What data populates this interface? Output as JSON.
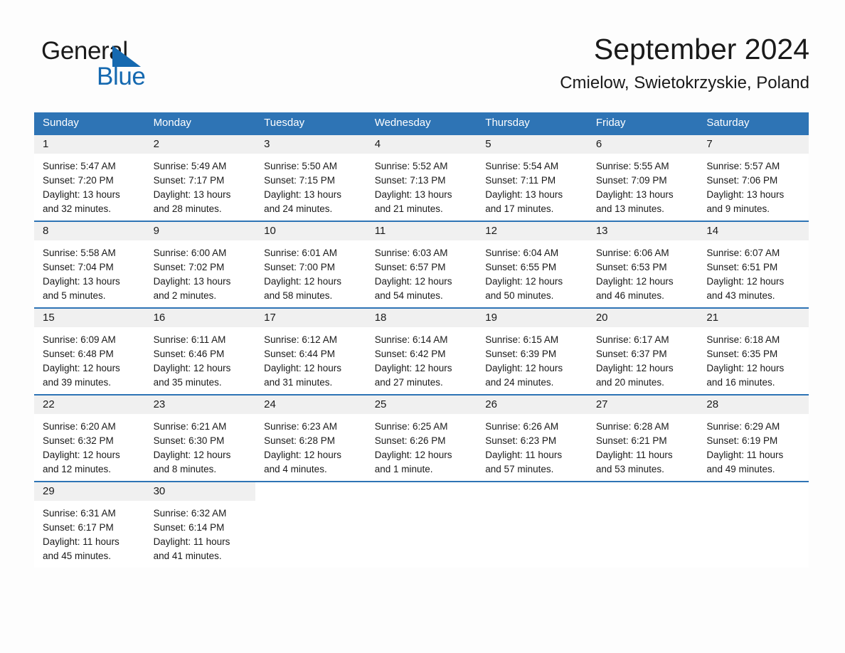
{
  "brand": {
    "name_part1": "General",
    "name_part2": "Blue",
    "accent_color": "#1569b0"
  },
  "header": {
    "title": "September 2024",
    "subtitle": "Cmielow, Swietokrzyskie, Poland"
  },
  "theme": {
    "header_blue": "#2e74b5",
    "daynum_band": "#f0f0f0",
    "page_background": "#fdfdfd"
  },
  "weekdays": [
    "Sunday",
    "Monday",
    "Tuesday",
    "Wednesday",
    "Thursday",
    "Friday",
    "Saturday"
  ],
  "weeks": [
    [
      {
        "day": "1",
        "sunrise": "Sunrise: 5:47 AM",
        "sunset": "Sunset: 7:20 PM",
        "daylight": "Daylight: 13 hours and 32 minutes."
      },
      {
        "day": "2",
        "sunrise": "Sunrise: 5:49 AM",
        "sunset": "Sunset: 7:17 PM",
        "daylight": "Daylight: 13 hours and 28 minutes."
      },
      {
        "day": "3",
        "sunrise": "Sunrise: 5:50 AM",
        "sunset": "Sunset: 7:15 PM",
        "daylight": "Daylight: 13 hours and 24 minutes."
      },
      {
        "day": "4",
        "sunrise": "Sunrise: 5:52 AM",
        "sunset": "Sunset: 7:13 PM",
        "daylight": "Daylight: 13 hours and 21 minutes."
      },
      {
        "day": "5",
        "sunrise": "Sunrise: 5:54 AM",
        "sunset": "Sunset: 7:11 PM",
        "daylight": "Daylight: 13 hours and 17 minutes."
      },
      {
        "day": "6",
        "sunrise": "Sunrise: 5:55 AM",
        "sunset": "Sunset: 7:09 PM",
        "daylight": "Daylight: 13 hours and 13 minutes."
      },
      {
        "day": "7",
        "sunrise": "Sunrise: 5:57 AM",
        "sunset": "Sunset: 7:06 PM",
        "daylight": "Daylight: 13 hours and 9 minutes."
      }
    ],
    [
      {
        "day": "8",
        "sunrise": "Sunrise: 5:58 AM",
        "sunset": "Sunset: 7:04 PM",
        "daylight": "Daylight: 13 hours and 5 minutes."
      },
      {
        "day": "9",
        "sunrise": "Sunrise: 6:00 AM",
        "sunset": "Sunset: 7:02 PM",
        "daylight": "Daylight: 13 hours and 2 minutes."
      },
      {
        "day": "10",
        "sunrise": "Sunrise: 6:01 AM",
        "sunset": "Sunset: 7:00 PM",
        "daylight": "Daylight: 12 hours and 58 minutes."
      },
      {
        "day": "11",
        "sunrise": "Sunrise: 6:03 AM",
        "sunset": "Sunset: 6:57 PM",
        "daylight": "Daylight: 12 hours and 54 minutes."
      },
      {
        "day": "12",
        "sunrise": "Sunrise: 6:04 AM",
        "sunset": "Sunset: 6:55 PM",
        "daylight": "Daylight: 12 hours and 50 minutes."
      },
      {
        "day": "13",
        "sunrise": "Sunrise: 6:06 AM",
        "sunset": "Sunset: 6:53 PM",
        "daylight": "Daylight: 12 hours and 46 minutes."
      },
      {
        "day": "14",
        "sunrise": "Sunrise: 6:07 AM",
        "sunset": "Sunset: 6:51 PM",
        "daylight": "Daylight: 12 hours and 43 minutes."
      }
    ],
    [
      {
        "day": "15",
        "sunrise": "Sunrise: 6:09 AM",
        "sunset": "Sunset: 6:48 PM",
        "daylight": "Daylight: 12 hours and 39 minutes."
      },
      {
        "day": "16",
        "sunrise": "Sunrise: 6:11 AM",
        "sunset": "Sunset: 6:46 PM",
        "daylight": "Daylight: 12 hours and 35 minutes."
      },
      {
        "day": "17",
        "sunrise": "Sunrise: 6:12 AM",
        "sunset": "Sunset: 6:44 PM",
        "daylight": "Daylight: 12 hours and 31 minutes."
      },
      {
        "day": "18",
        "sunrise": "Sunrise: 6:14 AM",
        "sunset": "Sunset: 6:42 PM",
        "daylight": "Daylight: 12 hours and 27 minutes."
      },
      {
        "day": "19",
        "sunrise": "Sunrise: 6:15 AM",
        "sunset": "Sunset: 6:39 PM",
        "daylight": "Daylight: 12 hours and 24 minutes."
      },
      {
        "day": "20",
        "sunrise": "Sunrise: 6:17 AM",
        "sunset": "Sunset: 6:37 PM",
        "daylight": "Daylight: 12 hours and 20 minutes."
      },
      {
        "day": "21",
        "sunrise": "Sunrise: 6:18 AM",
        "sunset": "Sunset: 6:35 PM",
        "daylight": "Daylight: 12 hours and 16 minutes."
      }
    ],
    [
      {
        "day": "22",
        "sunrise": "Sunrise: 6:20 AM",
        "sunset": "Sunset: 6:32 PM",
        "daylight": "Daylight: 12 hours and 12 minutes."
      },
      {
        "day": "23",
        "sunrise": "Sunrise: 6:21 AM",
        "sunset": "Sunset: 6:30 PM",
        "daylight": "Daylight: 12 hours and 8 minutes."
      },
      {
        "day": "24",
        "sunrise": "Sunrise: 6:23 AM",
        "sunset": "Sunset: 6:28 PM",
        "daylight": "Daylight: 12 hours and 4 minutes."
      },
      {
        "day": "25",
        "sunrise": "Sunrise: 6:25 AM",
        "sunset": "Sunset: 6:26 PM",
        "daylight": "Daylight: 12 hours and 1 minute."
      },
      {
        "day": "26",
        "sunrise": "Sunrise: 6:26 AM",
        "sunset": "Sunset: 6:23 PM",
        "daylight": "Daylight: 11 hours and 57 minutes."
      },
      {
        "day": "27",
        "sunrise": "Sunrise: 6:28 AM",
        "sunset": "Sunset: 6:21 PM",
        "daylight": "Daylight: 11 hours and 53 minutes."
      },
      {
        "day": "28",
        "sunrise": "Sunrise: 6:29 AM",
        "sunset": "Sunset: 6:19 PM",
        "daylight": "Daylight: 11 hours and 49 minutes."
      }
    ],
    [
      {
        "day": "29",
        "sunrise": "Sunrise: 6:31 AM",
        "sunset": "Sunset: 6:17 PM",
        "daylight": "Daylight: 11 hours and 45 minutes."
      },
      {
        "day": "30",
        "sunrise": "Sunrise: 6:32 AM",
        "sunset": "Sunset: 6:14 PM",
        "daylight": "Daylight: 11 hours and 41 minutes."
      },
      {
        "day": "",
        "sunrise": "",
        "sunset": "",
        "daylight": ""
      },
      {
        "day": "",
        "sunrise": "",
        "sunset": "",
        "daylight": ""
      },
      {
        "day": "",
        "sunrise": "",
        "sunset": "",
        "daylight": ""
      },
      {
        "day": "",
        "sunrise": "",
        "sunset": "",
        "daylight": ""
      },
      {
        "day": "",
        "sunrise": "",
        "sunset": "",
        "daylight": ""
      }
    ]
  ]
}
